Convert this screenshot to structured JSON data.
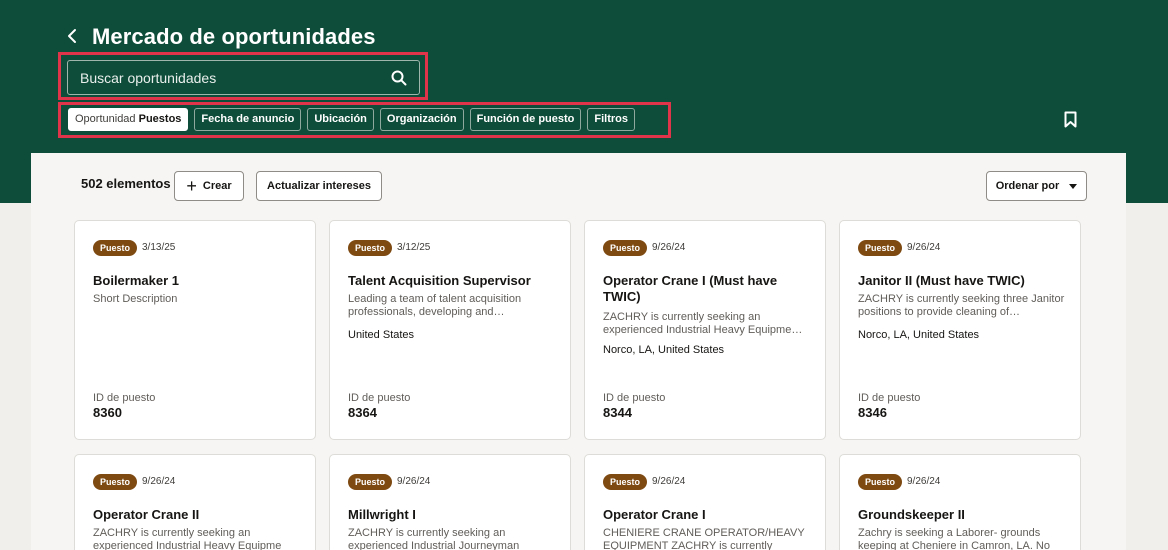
{
  "header": {
    "title": "Mercado de oportunidades",
    "search_placeholder": "Buscar oportunidades"
  },
  "filters": {
    "chips": [
      {
        "prefix": "Oportunidad",
        "label": "Puestos",
        "selected": true
      },
      {
        "label": "Fecha de anuncio"
      },
      {
        "label": "Ubicación"
      },
      {
        "label": "Organización"
      },
      {
        "label": "Función de puesto"
      },
      {
        "label": "Filtros"
      }
    ]
  },
  "toolbar": {
    "count": "502 elementos",
    "create_label": "Crear",
    "interests_label": "Actualizar intereses",
    "sort_label": "Ordenar por"
  },
  "colors": {
    "header_bg": "#0e4d3a",
    "badge_bg": "#7e4a12",
    "annotation": "#e0344a"
  },
  "cards": [
    {
      "badge": "Puesto",
      "date": "3/13/25",
      "title": "Boilermaker 1",
      "description": "Short Description",
      "location": "",
      "id_label": "ID de puesto",
      "id": "8360"
    },
    {
      "badge": "Puesto",
      "date": "3/12/25",
      "title": "Talent Acquisition Supervisor",
      "description": "Leading a team of talent acquisition professionals, developing and…",
      "location": "United States",
      "id_label": "ID de puesto",
      "id": "8364"
    },
    {
      "badge": "Puesto",
      "date": "9/26/24",
      "title": "Operator Crane I (Must have TWIC)",
      "description": "ZACHRY is currently seeking an experienced Industrial Heavy Equipme…",
      "location": "Norco, LA, United States",
      "id_label": "ID de puesto",
      "id": "8344"
    },
    {
      "badge": "Puesto",
      "date": "9/26/24",
      "title": "Janitor II (Must have TWIC)",
      "description": "ZACHRY is currently seeking three Janitor positions to provide cleaning of…",
      "location": "Norco, LA, United States",
      "id_label": "ID de puesto",
      "id": "8346"
    },
    {
      "badge": "Puesto",
      "date": "9/26/24",
      "title": "Operator Crane II",
      "description": "ZACHRY is currently seeking an experienced Industrial Heavy Equipme"
    },
    {
      "badge": "Puesto",
      "date": "9/26/24",
      "title": "Millwright I",
      "description": "ZACHRY is currently seeking an experienced Industrial Journeyman"
    },
    {
      "badge": "Puesto",
      "date": "9/26/24",
      "title": "Operator Crane I",
      "description": "CHENIERE CRANE OPERATOR/HEAVY EQUIPMENT ZACHRY is currently"
    },
    {
      "badge": "Puesto",
      "date": "9/26/24",
      "title": "Groundskeeper II",
      "description": "Zachry is seeking a Laborer- grounds keeping at Cheniere in Camron, LA. No"
    }
  ]
}
